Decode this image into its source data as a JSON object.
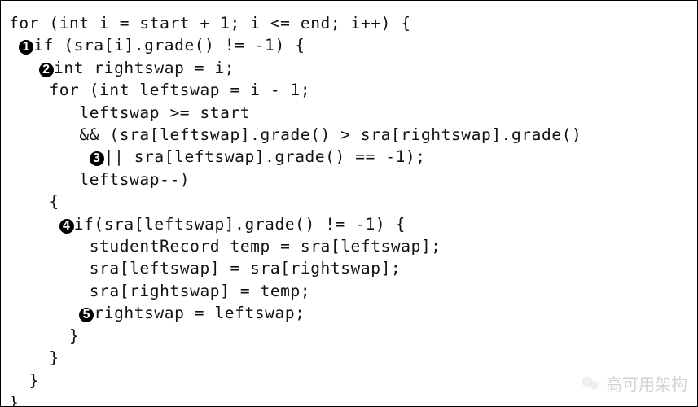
{
  "code": {
    "lines": [
      "for (int i = start + 1; i <= end; i++) {",
      "if (sra[i].grade() != -1) {",
      "int rightswap = i;",
      "    for (int leftswap = i - 1;",
      "       leftswap >= start",
      "       && (sra[leftswap].grade() > sra[rightswap].grade()",
      "|| sra[leftswap].grade() == -1);",
      "       leftswap--)",
      "    {",
      "if(sra[leftswap].grade() != -1) {",
      "        studentRecord temp = sra[leftswap];",
      "        sra[leftswap] = sra[rightswap];",
      "        sra[rightswap] = temp;",
      "rightswap = leftswap;",
      "      }",
      "    }",
      "  }",
      "}"
    ],
    "bullets": [
      "1",
      "2",
      "3",
      "4",
      "5"
    ]
  },
  "watermark": {
    "text": "高可用架构"
  }
}
